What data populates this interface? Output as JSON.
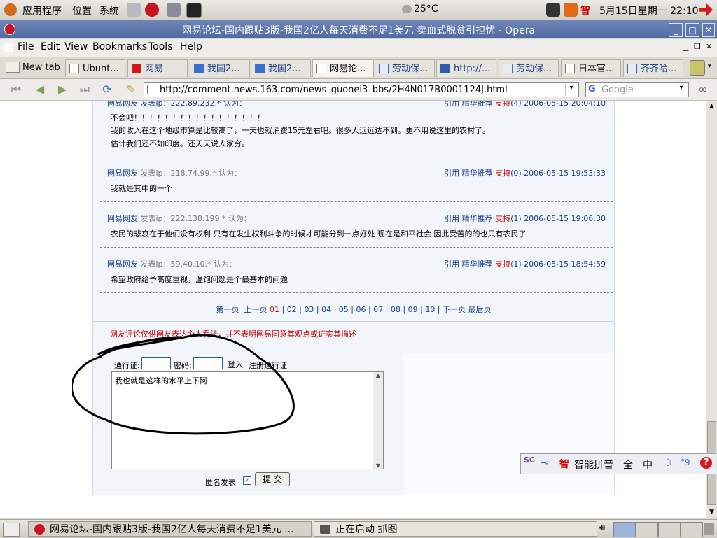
{
  "panel": {
    "apps_label": "应用程序",
    "places_label": "位置",
    "system_label": "系统",
    "weather": "25°C",
    "zhi": "智",
    "clock": "5月15日星期一 22:10",
    "accent": "#de4a1c"
  },
  "window": {
    "title": "网易论坛-国内跟贴3版-我国2亿人每天消费不足1美元 卖血式脱贫引担忧 - Opera"
  },
  "menu": [
    "File",
    "Edit",
    "View",
    "Bookmarks",
    "Tools",
    "Help"
  ],
  "tabs": {
    "new_tab": "New tab",
    "items": [
      "Ubunt...",
      "网易",
      "我国2...",
      "我国2...",
      "网易论...",
      "劳动保...",
      "http://...",
      "劳动保...",
      "日本官...",
      "齐齐哈..."
    ]
  },
  "nav": {
    "url": "http://comment.news.163.com/news_guonei3_bbs/2H4N017B0001124J.html",
    "search_placeholder": "Google"
  },
  "comments": {
    "top_meta": "网易网友 发表ip：222.89.232.* 认为：",
    "top_right_links": "引用 精华推荐",
    "top_right_support": "支持",
    "top_right_rest": "(4) 2006-05-15 20:04:10",
    "top_lines": [
      "不会吧！！！！！！！！！！！！！！！！！",
      "我的收入在这个地级市算是比较高了，一天也就消费15元左右吧。很多人远远达不到。更不用说这里的农村了。",
      "估计我们还不如印度。还天天说人家穷。"
    ],
    "items": [
      {
        "user": "网易网友",
        "ip": "发表ip：218.74.99.* 认为：",
        "links": "引用 精华推荐",
        "support": "支持",
        "rest": "(0) 2006-05-15 19:53:33",
        "text": "我就是其中的一个"
      },
      {
        "user": "网易网友",
        "ip": "发表ip：222.138.199.* 认为：",
        "links": "引用 精华推荐",
        "support": "支持",
        "rest": "(1) 2006-05-15 19:06:30",
        "text": "农民的悲哀在于他们没有权利 只有在发生权利斗争的时候才可能分到一点好处 现在是和平社会 因此受苦的的也只有农民了"
      },
      {
        "user": "网易网友",
        "ip": "发表ip：59.40.10.* 认为：",
        "links": "引用 精华推荐",
        "support": "支持",
        "rest": "(1) 2006-05-15 18:54:59",
        "text": "希望政府给予高度重视，温饱问题是个最基本的问题"
      }
    ]
  },
  "pagination": {
    "first": "第一页",
    "prev": "上一页",
    "current": "01",
    "pages": [
      "02",
      "03",
      "04",
      "05",
      "06",
      "07",
      "08",
      "09",
      "10"
    ],
    "next": "下一页",
    "last": "最后页"
  },
  "disclaimer": "网友评论仅供网友表达个人看法，并不表明网易同意其观点或证实其描述",
  "form": {
    "pass_label": "通行证:",
    "pwd_label": "密码:",
    "login": "登入",
    "register": "注册通行证",
    "textarea_value": "我也就是这样的水平上下阿",
    "anon_label": "匿名发表",
    "anon_checked": "✓",
    "submit": "提 交"
  },
  "ime": {
    "label1": "智能拼音",
    "label2": "全",
    "label3": "中",
    "moon": "☽",
    "dots": "°9",
    "help": "?"
  },
  "taskbar": {
    "opera_task": "网易论坛-国内跟贴3版-我国2亿人每天消费不足1美元 ...",
    "screenshot_task": "正在启动 抓图"
  }
}
